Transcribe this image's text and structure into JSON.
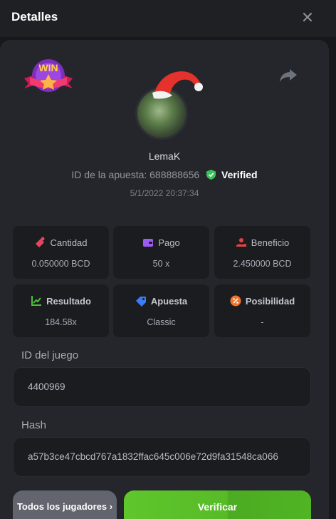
{
  "header": {
    "title": "Detalles",
    "close_icon": "close-icon"
  },
  "bet": {
    "win_badge_text": "WIN",
    "username": "LemaK",
    "bet_id_label": "ID de la apuesta: 688888656",
    "verified_label": "Verified",
    "timestamp": "5/1/2022 20:37:34"
  },
  "stats": [
    {
      "label": "Cantidad",
      "value": "0.050000 BCD",
      "icon": "coins-icon",
      "icon_color": "#e8455d"
    },
    {
      "label": "Pago",
      "value": "50 x",
      "icon": "wallet-icon",
      "icon_color": "#9b5cf6"
    },
    {
      "label": "Beneficio",
      "value": "2.450000 BCD",
      "icon": "hand-coin-icon",
      "icon_color": "#e2433f"
    },
    {
      "label": "Resultado",
      "value": "184.58x",
      "icon": "chart-icon",
      "icon_color": "#4cbf3a"
    },
    {
      "label": "Apuesta",
      "value": "Classic",
      "icon": "tag-icon",
      "icon_color": "#3b7cf4"
    },
    {
      "label": "Posibilidad",
      "value": "-",
      "icon": "percent-icon",
      "icon_color": "#f0732a"
    }
  ],
  "game_id": {
    "label": "ID del juego",
    "value": "4400969"
  },
  "hash": {
    "label": "Hash",
    "value": "a57b3ce47cbcd767a1832ffac645c006e72d9fa31548ca066"
  },
  "buttons": {
    "all_players": "Todos los jugadores ›",
    "verify": "Verificar"
  },
  "colors": {
    "accent_green": "#5fc62c",
    "panel": "#24262b",
    "card": "#1b1c20"
  }
}
